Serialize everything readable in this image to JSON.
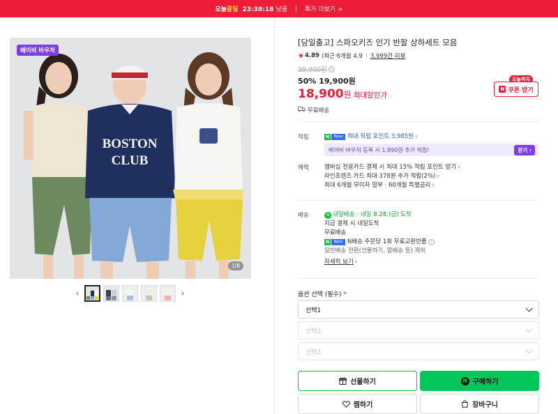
{
  "banner": {
    "today_prefix": "오늘",
    "today_highlight": "끝딜",
    "timer": "23:38:18",
    "timer_suffix": "남음",
    "more_label": "특가 더보기",
    "more_chevron": ">"
  },
  "gallery": {
    "voucher_badge": "베이비 바우처",
    "counter": "1/8",
    "prev_icon": "chevron-left-icon",
    "next_icon": "chevron-right-icon",
    "prev_glyph": "‹",
    "next_glyph": "›",
    "thumbnails": 5,
    "active_thumb": 1,
    "image_texts": {
      "shirt_line1": "BOSTON",
      "shirt_line2": "CLUB"
    }
  },
  "product": {
    "title": "[당일출고] 스파오키즈 인기 반팔 상하세트 모음",
    "rating": "4.89",
    "rating_detail": "(최근 6개월 4.9",
    "reviews": "3,999건 리뷰",
    "original_price": "39,900원",
    "discount_pct": "50%",
    "discount_price": "19,900원",
    "final_price": "18,900",
    "final_unit": "원",
    "final_label": "최대할인가",
    "shipping": "무료배송"
  },
  "coupon": {
    "tag": "오늘까지",
    "button": "쿠폰 받기",
    "n": "N"
  },
  "points": {
    "label": "적립",
    "npay_n": "N",
    "npay_pay": "Npay",
    "max_points": "최대 적립 포인트 3,985원",
    "voucher_text": "베이비 바우처 등록 시 1,890원 추가 적립!",
    "voucher_button": "받기"
  },
  "benefits": {
    "label": "혜택",
    "lines": [
      "멤버십 전용카드 결제 시 최대 15% 적립 포인트 받기",
      "라인프렌즈 카드 최대 378원 추가 적립(2%)",
      "최대 6개월 무이자 할부 · 60개월 특별금리"
    ]
  },
  "delivery": {
    "label": "배송",
    "tomorrow_badge": "내일배송",
    "tomorrow_date": "내일 8.28.(금) 도착",
    "order_now": "지금 결제 시 내일도착",
    "free": "무료배송",
    "return_text": "N배송 주문당 1회 무료교환반품",
    "return_note": "일반배송 전환(선물하기, 합배송 등) 제외",
    "more": "자세히 보기"
  },
  "options": {
    "label": "옵션 선택 (필수)",
    "required_mark": "*",
    "selects": [
      "선택1",
      "선택2",
      "선택3"
    ]
  },
  "actions": {
    "gift": "선물하기",
    "buy": "구매하기",
    "wish": "찜하기",
    "cart": "장바구니"
  },
  "colors": {
    "brand_red": "#ee1c36",
    "naver_green": "#03c75a",
    "voucher_purple": "#7b3fe4"
  }
}
